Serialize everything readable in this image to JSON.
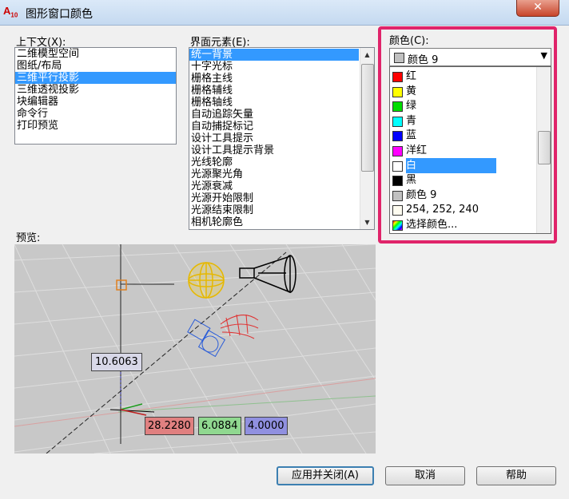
{
  "window": {
    "icon_text": "A",
    "icon_sub": "10",
    "title": "图形窗口颜色",
    "close_glyph": "✕"
  },
  "context": {
    "label": "上下文(X):",
    "items": [
      "二维模型空间",
      "图纸/布局",
      "三维平行投影",
      "三维透视投影",
      "块编辑器",
      "命令行",
      "打印预览"
    ],
    "selected_index": 2
  },
  "elements": {
    "label": "界面元素(E):",
    "items": [
      "统一背景",
      "十字光标",
      "栅格主线",
      "栅格辅线",
      "栅格轴线",
      "自动追踪矢量",
      "自动捕捉标记",
      "设计工具提示",
      "设计工具提示背景",
      "光线轮廓",
      "光源聚光角",
      "光源衰减",
      "光源开始限制",
      "光源结束限制",
      "相机轮廓色"
    ],
    "selected_index": 0
  },
  "color": {
    "label": "颜色(C):",
    "current": "颜色 9",
    "current_color": "#c0c0c0",
    "options": [
      {
        "label": "红",
        "color": "#ff0000"
      },
      {
        "label": "黄",
        "color": "#ffff00"
      },
      {
        "label": "绿",
        "color": "#00dd00"
      },
      {
        "label": "青",
        "color": "#00ffff"
      },
      {
        "label": "蓝",
        "color": "#0000ff"
      },
      {
        "label": "洋红",
        "color": "#ff00ff"
      },
      {
        "label": "白",
        "color": "#ffffff"
      },
      {
        "label": "黑",
        "color": "#000000"
      },
      {
        "label": "颜色 9",
        "color": "#c0c0c0"
      },
      {
        "label": "254, 252, 240",
        "color": "#fefcf0"
      },
      {
        "label": "选择颜色...",
        "color": "multi"
      }
    ],
    "selected_index": 6,
    "highlight_color": "#e0246a"
  },
  "preview": {
    "label": "预览:",
    "dim_top": "10.6063",
    "dim_x": "28.2280",
    "dim_y": "6.0884",
    "dim_z": "4.0000"
  },
  "buttons": {
    "apply_close": "应用并关闭(A)",
    "cancel": "取消",
    "help": "帮助"
  }
}
